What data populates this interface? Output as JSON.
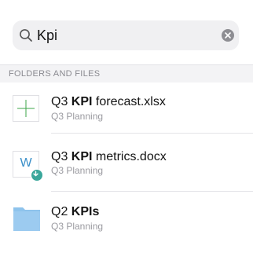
{
  "search": {
    "query": "Kpi"
  },
  "section": {
    "header": "FOLDERS AND FILES"
  },
  "results": [
    {
      "title_prefix": "Q3 ",
      "title_match": "KPI",
      "title_suffix": " forecast.xlsx",
      "location": "Q3 Planning",
      "icon": "spreadsheet-icon",
      "icon_color": "#3da64a"
    },
    {
      "title_prefix": "Q3 ",
      "title_match": "KPI",
      "title_suffix": " metrics.docx",
      "location": "Q3 Planning",
      "icon": "word-document-icon",
      "icon_letter": "W",
      "icon_color": "#3a8fc9",
      "badge": "synced-badge-icon",
      "badge_color": "#3aa79b"
    },
    {
      "title_prefix": "Q2 ",
      "title_match": "KPIs",
      "title_suffix": "",
      "location": "Q3 Planning",
      "icon": "folder-icon",
      "icon_color": "#8ec3ec"
    }
  ]
}
